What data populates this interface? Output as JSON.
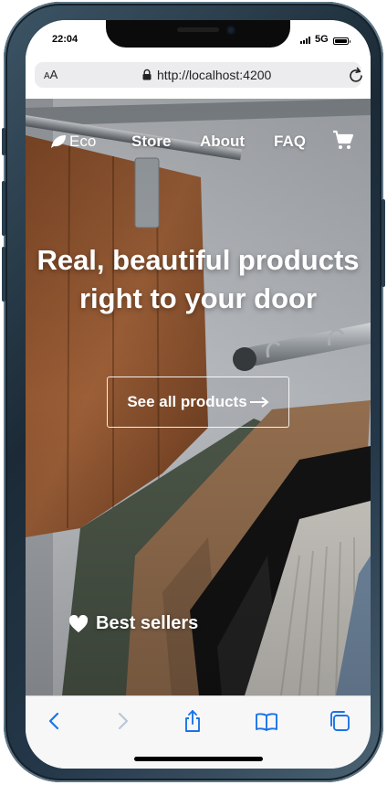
{
  "status_bar": {
    "time": "22:04",
    "network": "5G"
  },
  "browser": {
    "text_size_label_small": "A",
    "text_size_label_large": "A",
    "url": "http://localhost:4200"
  },
  "site": {
    "logo_text": "Eco",
    "nav": {
      "store": "Store",
      "about": "About",
      "faq": "FAQ"
    },
    "hero": {
      "headline_line1": "Real, beautiful products",
      "headline_line2": "right to your door",
      "cta_label": "See all products"
    },
    "best_sellers_label": "Best sellers"
  },
  "icons": {
    "logo": "leaf-icon",
    "cart": "shopping-cart-icon",
    "cta_arrow": "arrow-right-icon",
    "best_sellers": "heart-icon",
    "toolbar": [
      "back-icon",
      "forward-icon",
      "share-icon",
      "bookmarks-icon",
      "tabs-icon"
    ]
  },
  "colors": {
    "browser_accent": "#1a73e8",
    "hero_text": "#ffffff"
  }
}
